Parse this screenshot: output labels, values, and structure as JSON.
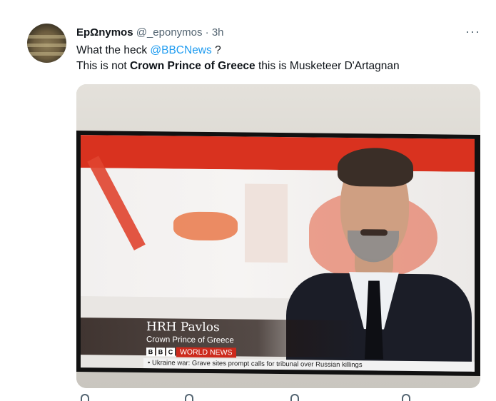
{
  "tweet": {
    "display_name": "EpΩnymos",
    "handle": "@_eponymos",
    "separator": "·",
    "time": "3h",
    "more_label": "···",
    "line1_prefix": "What the heck ",
    "line1_mention": "@BBCNews",
    "line1_suffix": " ?",
    "line2_prefix": "This is not ",
    "line2_bold": "Crown Prince of Greece",
    "line2_suffix": " this is Musketeer D'Artagnan"
  },
  "media": {
    "lower_third_name": "HRH Pavlos",
    "lower_third_title": "Crown Prince of Greece",
    "bbc_blocks": [
      "B",
      "B",
      "C"
    ],
    "channel": "WORLD NEWS",
    "ticker": "• Ukraine war: Grave sites prompt calls for tribunal over Russian killings"
  },
  "actions": [
    "reply-icon",
    "retweet-icon",
    "like-icon",
    "share-icon"
  ],
  "colors": {
    "mention": "#1d9bf0",
    "secondary_text": "#536471",
    "bbc_red": "#cc2a1c"
  }
}
